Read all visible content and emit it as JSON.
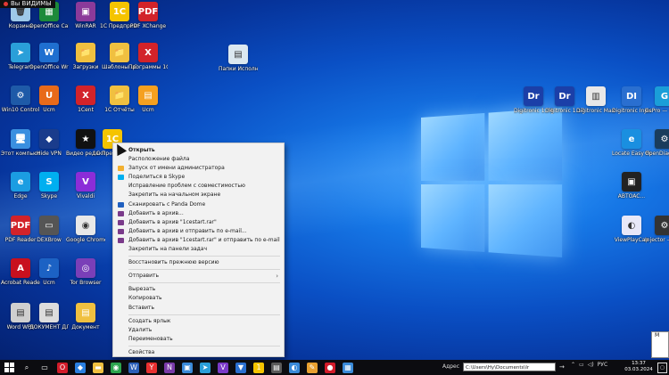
{
  "recording_badge": "Вы ВИДИМЫ",
  "desktop_icons_left": [
    {
      "label": "Корзина",
      "color": "#9ec9e8",
      "glyph": "🗑"
    },
    {
      "label": "OpenOffice Calc",
      "color": "#1d8a3a",
      "glyph": "▦"
    },
    {
      "label": "WinRAR",
      "color": "#8b3a9a",
      "glyph": "▣"
    },
    {
      "label": "1С Предприятие",
      "color": "#f5c400",
      "glyph": "1С"
    },
    {
      "label": "PDF XChange",
      "color": "#d2232a",
      "glyph": "PDF"
    },
    {
      "label": "Telegram",
      "color": "#2a9fd9",
      "glyph": "➤"
    },
    {
      "label": "OpenOffice Writer",
      "color": "#1f6fd0",
      "glyph": "W"
    },
    {
      "label": "Загрузки",
      "color": "#f0c040",
      "glyph": "📁"
    },
    {
      "label": "Шаблоны 1С",
      "color": "#f0c040",
      "glyph": "📁"
    },
    {
      "label": "Программы 1С",
      "color": "#d2232a",
      "glyph": "X"
    },
    {
      "label": "Win10 Control",
      "color": "#1e5aa8",
      "glyph": "⚙"
    },
    {
      "label": "Ucm",
      "color": "#e86a1a",
      "glyph": "U"
    },
    {
      "label": "1Cent",
      "color": "#d2232a",
      "glyph": "X"
    },
    {
      "label": "1С Отчёты",
      "color": "#f0c040",
      "glyph": "📁"
    },
    {
      "label": "Ucm",
      "color": "#f5a020",
      "glyph": "▤"
    },
    {
      "label": "Этот компьютер",
      "color": "#3a8fe0",
      "glyph": "🖥"
    },
    {
      "label": "Hide VPN",
      "color": "#1a3c8c",
      "glyph": "◆"
    },
    {
      "label": "Видео редактор",
      "color": "#111111",
      "glyph": "★"
    },
    {
      "label": "1С Предприятие",
      "color": "#f5c400",
      "glyph": "1С"
    },
    {
      "label": "Edge",
      "color": "#1b9de2",
      "glyph": "e"
    },
    {
      "label": "Skype",
      "color": "#00aff0",
      "glyph": "S"
    },
    {
      "label": "Vivaldi",
      "color": "#8b2dd8",
      "glyph": "V"
    },
    {
      "label": "PDF Reader",
      "color": "#d2232a",
      "glyph": "PDF"
    },
    {
      "label": "DEXBrow",
      "color": "#555555",
      "glyph": "▭"
    },
    {
      "label": "Google Chrome",
      "color": "#e8e8e8",
      "glyph": "◉"
    },
    {
      "label": "Acrobat Reader",
      "color": "#c8101e",
      "glyph": "A"
    },
    {
      "label": "Ucm",
      "color": "#1c62c4",
      "glyph": "♪"
    },
    {
      "label": "Tor Browser",
      "color": "#7a3fb8",
      "glyph": "◎"
    },
    {
      "label": "Word WPS",
      "color": "#cfcfcf",
      "glyph": "▤"
    },
    {
      "label": "ДОКУМЕНТ ДЛЯ ДОМА",
      "color": "#dcdcdc",
      "glyph": "▤"
    },
    {
      "label": "Документ",
      "color": "#f0c040",
      "glyph": "▤"
    }
  ],
  "desktop_icons_right": [
    {
      "label": "Папки Исполнение",
      "color": "#dce8f0",
      "glyph": "▤"
    },
    {
      "label": "Digitronic 1.74.1.0",
      "color": "#1b3fa8",
      "glyph": "Dr"
    },
    {
      "label": "Digitronic 1.17.0.3",
      "color": "#1b3fa8",
      "glyph": "Dr"
    },
    {
      "label": "Digitronic Max2.0.29.10",
      "color": "#e8e8e8",
      "glyph": "▥"
    },
    {
      "label": "Digitronic Injectio...",
      "color": "#2a6fd0",
      "glyph": "DI"
    },
    {
      "label": "GsPro — ярлык",
      "color": "#1a9ed8",
      "glyph": "G"
    },
    {
      "label": "Locate Easy Fixit",
      "color": "#1a8fe0",
      "glyph": "e"
    },
    {
      "label": "OpenDiagPro — ярлык",
      "color": "#1a3c5c",
      "glyph": "⚙"
    },
    {
      "label": "ABTOAC...",
      "color": "#222222",
      "glyph": "▣"
    },
    {
      "label": "ViewPlayCap",
      "color": "#e8e8f8",
      "glyph": "◐"
    },
    {
      "label": "Injector — ярлык",
      "color": "#333333",
      "glyph": "⚙"
    }
  ],
  "context_menu": {
    "items": [
      {
        "label": "Открыть",
        "bold": true,
        "icon_color": "",
        "separator_after": false
      },
      {
        "label": "Расположение файла",
        "bold": false,
        "icon_color": "",
        "separator_after": false
      },
      {
        "label": "Запуск от имени администратора",
        "bold": false,
        "icon_color": "#f2b030",
        "separator_after": false
      },
      {
        "label": "Поделиться в Skype",
        "bold": false,
        "icon_color": "#00aff0",
        "separator_after": false
      },
      {
        "label": "Исправление проблем с совместимостью",
        "bold": false,
        "icon_color": "",
        "separator_after": false
      },
      {
        "label": "Закрепить на начальном экране",
        "bold": false,
        "icon_color": "",
        "separator_after": false
      },
      {
        "label": "Сканировать с Panda Dome",
        "bold": false,
        "icon_color": "#1f5fbf",
        "separator_after": false
      },
      {
        "label": "Добавить в архив...",
        "bold": false,
        "icon_color": "#7a3a8a",
        "separator_after": false
      },
      {
        "label": "Добавить в архив \"1cestart.rar\"",
        "bold": false,
        "icon_color": "#7a3a8a",
        "separator_after": false
      },
      {
        "label": "Добавить в архив и отправить по e-mail...",
        "bold": false,
        "icon_color": "#7a3a8a",
        "separator_after": false
      },
      {
        "label": "Добавить в архив \"1cestart.rar\" и отправить по e-mail",
        "bold": false,
        "icon_color": "#7a3a8a",
        "separator_after": false
      },
      {
        "label": "Закрепить на панели задач",
        "bold": false,
        "icon_color": "",
        "separator_after": true
      },
      {
        "label": "Восстановить прежнюю версию",
        "bold": false,
        "icon_color": "",
        "separator_after": true
      },
      {
        "label": "Отправить",
        "bold": false,
        "icon_color": "",
        "separator_after": true,
        "submenu": true
      },
      {
        "label": "Вырезать",
        "bold": false,
        "icon_color": "",
        "separator_after": false
      },
      {
        "label": "Копировать",
        "bold": false,
        "icon_color": "",
        "separator_after": false
      },
      {
        "label": "Вставить",
        "bold": false,
        "icon_color": "",
        "separator_after": true
      },
      {
        "label": "Создать ярлык",
        "bold": false,
        "icon_color": "",
        "separator_after": false
      },
      {
        "label": "Удалить",
        "bold": false,
        "icon_color": "",
        "separator_after": false
      },
      {
        "label": "Переименовать",
        "bold": false,
        "icon_color": "",
        "separator_after": true
      },
      {
        "label": "Свойства",
        "bold": false,
        "icon_color": "",
        "separator_after": false
      }
    ]
  },
  "taskbar": {
    "apps": [
      {
        "name": "search-icon",
        "glyph": "⌕",
        "color": "#0c0c10"
      },
      {
        "name": "task-view-icon",
        "glyph": "▭",
        "color": "#0c0c10"
      },
      {
        "name": "opera-icon",
        "glyph": "O",
        "color": "#d21c2a"
      },
      {
        "name": "dropbox-icon",
        "glyph": "◆",
        "color": "#2a7fe0"
      },
      {
        "name": "file-explorer-icon",
        "glyph": "▬",
        "color": "#f0c040"
      },
      {
        "name": "chrome-icon",
        "glyph": "◉",
        "color": "#2da44e"
      },
      {
        "name": "word-icon",
        "glyph": "W",
        "color": "#2b5fb8"
      },
      {
        "name": "yandex-icon",
        "glyph": "Y",
        "color": "#e83030"
      },
      {
        "name": "onenote-icon",
        "glyph": "N",
        "color": "#7a3aa8"
      },
      {
        "name": "photos-icon",
        "glyph": "▣",
        "color": "#3a8ad8"
      },
      {
        "name": "telegram-icon",
        "glyph": "➤",
        "color": "#2a9fd9"
      },
      {
        "name": "vs-icon",
        "glyph": "V",
        "color": "#7a3ac8"
      },
      {
        "name": "vpn-icon",
        "glyph": "▼",
        "color": "#2a6fd0"
      },
      {
        "name": "1c-icon",
        "glyph": "1",
        "color": "#f5c400"
      },
      {
        "name": "app-icon",
        "glyph": "▤",
        "color": "#5a5a5a"
      },
      {
        "name": "screen-icon",
        "glyph": "◐",
        "color": "#3a8ad8"
      },
      {
        "name": "pin-icon",
        "glyph": "✎",
        "color": "#e8a030"
      },
      {
        "name": "record-icon",
        "glyph": "●",
        "color": "#d21c2a"
      },
      {
        "name": "capture-icon",
        "glyph": "▦",
        "color": "#3a8ad8"
      }
    ],
    "address_label": "Адрес",
    "address_value": "C:\\Users\\Hy\\Documents\\Ir",
    "language": "РУС",
    "time": "13:37",
    "date": "03.03.2024",
    "thumbnail_letter": "M"
  }
}
